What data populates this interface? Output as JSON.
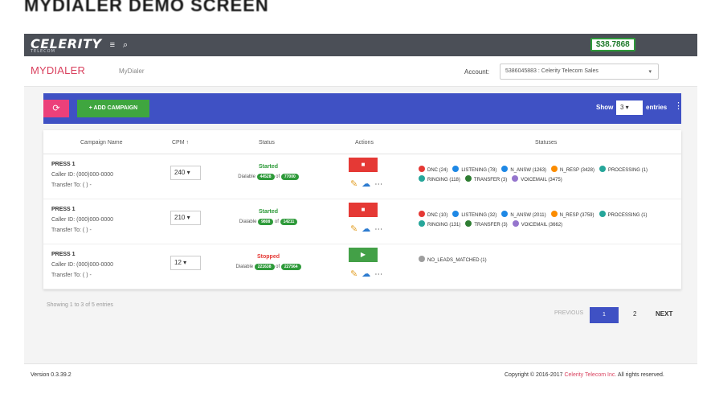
{
  "page_heading": "MYDIALER DEMO SCREEN",
  "topbar": {
    "logo": "CELERITY",
    "logo_sub": "TELECOM",
    "menu_icon": "≡",
    "search_icon": "⌕",
    "balance": "$38.7868"
  },
  "header": {
    "title": "MYDIALER",
    "breadcrumb": "MyDialer",
    "account_label": "Account:",
    "account_value": "5386045883 : Celerity Telecom Sales",
    "account_caret": "▾"
  },
  "toolbar": {
    "refresh_icon": "⟳",
    "add_label": "+ ADD CAMPAIGN",
    "show_label": "Show",
    "show_value": "3 ▾",
    "entries_label": "entries",
    "more_icon": "⋮"
  },
  "table": {
    "headers": {
      "name": "Campaign Name",
      "cpm": "CPM ↑",
      "status": "Status",
      "actions": "Actions",
      "statuses": "Statuses"
    },
    "rows": [
      {
        "name": "PRESS 1",
        "caller_label": "Caller ID:",
        "caller_id": "(000)000-0000",
        "transfer_label": "Transfer To:",
        "transfer_value": "( )   -",
        "cpm": "240 ▾",
        "status": "Started",
        "dialable_label": "Dialable",
        "dialable_a": "44528",
        "of_label": "of",
        "dialable_b": "77000",
        "action_label": "■",
        "action_color": "#e53935",
        "statuses": [
          {
            "label": "DNC (24)",
            "color": "#e53935"
          },
          {
            "label": "LISTENING (78)",
            "color": "#1e88e5"
          },
          {
            "label": "N_ANSW (1263)",
            "color": "#1e88e5"
          },
          {
            "label": "N_RESP (3428)",
            "color": "#fb8c00"
          },
          {
            "label": "PROCESSING (1)",
            "color": "#26a69a"
          },
          {
            "label": "RINGING (118)",
            "color": "#26a69a"
          },
          {
            "label": "TRANSFER (3)",
            "color": "#2e7d32"
          },
          {
            "label": "VOICEMAIL (3475)",
            "color": "#9575cd"
          }
        ]
      },
      {
        "name": "PRESS 1",
        "caller_label": "Caller ID:",
        "caller_id": "(000)000-0000",
        "transfer_label": "Transfer To:",
        "transfer_value": "( )   -",
        "cpm": "210 ▾",
        "status": "Started",
        "dialable_label": "Dialable",
        "dialable_a": "9808",
        "of_label": "of",
        "dialable_b": "14211",
        "action_label": "■",
        "action_color": "#e53935",
        "statuses": [
          {
            "label": "DNC (10)",
            "color": "#e53935"
          },
          {
            "label": "LISTENING (32)",
            "color": "#1e88e5"
          },
          {
            "label": "N_ANSW (2011)",
            "color": "#1e88e5"
          },
          {
            "label": "N_RESP (3759)",
            "color": "#fb8c00"
          },
          {
            "label": "PROCESSING (1)",
            "color": "#26a69a"
          },
          {
            "label": "RINGING (131)",
            "color": "#26a69a"
          },
          {
            "label": "TRANSFER (3)",
            "color": "#2e7d32"
          },
          {
            "label": "VOICEMAIL (3662)",
            "color": "#9575cd"
          }
        ]
      },
      {
        "name": "PRESS 1",
        "caller_label": "Caller ID:",
        "caller_id": "(000)000-0000",
        "transfer_label": "Transfer To:",
        "transfer_value": "( )   -",
        "cpm": "12 ▾",
        "status": "Stopped",
        "dialable_label": "Dialable",
        "dialable_a": "221638",
        "of_label": "of",
        "dialable_b": "227564",
        "action_label": "▶",
        "action_color": "#43a047",
        "statuses": [
          {
            "label": "NO_LEADS_MATCHED (1)",
            "color": "#9e9e9e"
          }
        ]
      }
    ]
  },
  "footer": {
    "info": "Showing 1 to 3 of 5 entries",
    "prev": "PREVIOUS",
    "page1": "1",
    "page2": "2",
    "next": "NEXT",
    "version": "Version 0.3.39.2",
    "copyright": "Copyright © 2016-2017",
    "company": "Celerity Telecom Inc.",
    "rights": "All rights reserved."
  },
  "colors": {
    "started": "#2e9a3a",
    "stopped": "#e53935",
    "accent": "#3f51c4",
    "brand": "#d9425f"
  }
}
